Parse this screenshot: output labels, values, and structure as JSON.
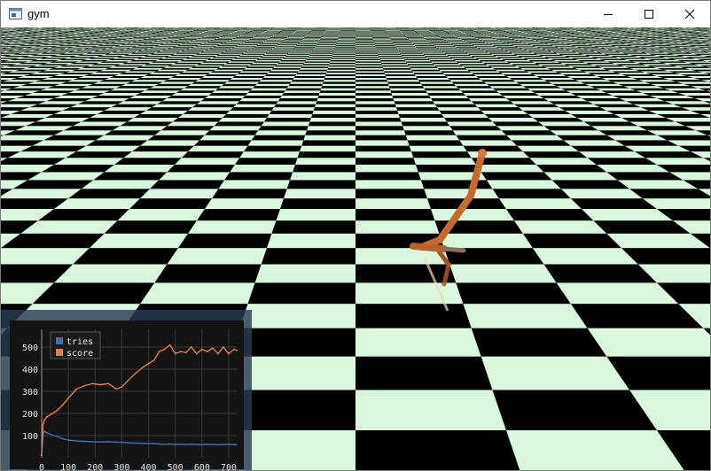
{
  "window": {
    "title": "gym",
    "icons": {
      "app": "app-window-icon",
      "minimize": "minimize-icon",
      "maximize": "maximize-icon",
      "close": "close-icon"
    }
  },
  "scene": {
    "floor": "checkerboard",
    "floor_colors": {
      "light": "#d8f7dc",
      "dark": "#000000"
    },
    "agent_color": "#c86a2c"
  },
  "chart_data": {
    "type": "line",
    "x": [
      0,
      5,
      10,
      20,
      40,
      60,
      80,
      100,
      130,
      160,
      190,
      220,
      250,
      280,
      300,
      320,
      350,
      380,
      400,
      420,
      440,
      460,
      480,
      500,
      520,
      540,
      560,
      580,
      600,
      620,
      640,
      660,
      680,
      700,
      720,
      730
    ],
    "series": [
      {
        "name": "tries",
        "color": "#3f6db5",
        "values": [
          10,
          100,
          120,
          112,
          102,
          95,
          85,
          80,
          76,
          74,
          72,
          71,
          72,
          70,
          70,
          68,
          66,
          65,
          64,
          64,
          62,
          61,
          62,
          60,
          61,
          60,
          61,
          60,
          60,
          61,
          60,
          59,
          60,
          61,
          60,
          59
        ]
      },
      {
        "name": "score",
        "color": "#e07d45",
        "values": [
          10,
          150,
          170,
          185,
          200,
          215,
          240,
          270,
          310,
          325,
          335,
          330,
          335,
          310,
          320,
          345,
          380,
          410,
          425,
          440,
          480,
          490,
          510,
          470,
          480,
          475,
          500,
          470,
          490,
          480,
          495,
          470,
          500,
          470,
          490,
          485
        ]
      }
    ],
    "xlim": [
      0,
      730
    ],
    "ylim": [
      0,
      580
    ],
    "xticks": [
      "0",
      "100",
      "200",
      "300",
      "400",
      "500",
      "600",
      "700"
    ],
    "yticks": [
      "100",
      "200",
      "300",
      "400",
      "500"
    ],
    "legend": "top-left",
    "grid": true
  }
}
